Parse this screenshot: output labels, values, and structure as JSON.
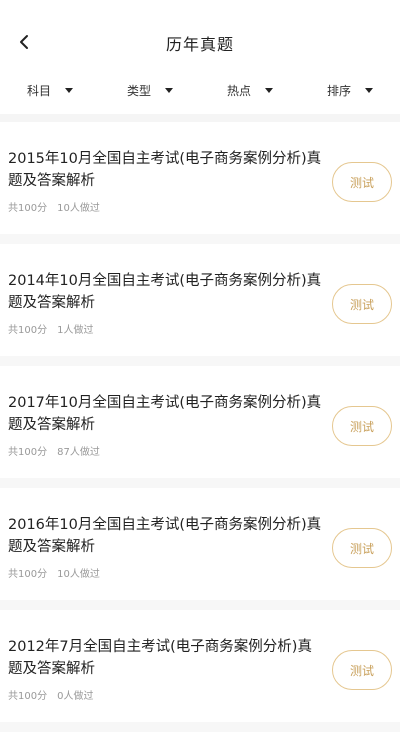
{
  "header": {
    "title": "历年真题"
  },
  "filters": [
    {
      "label": "科目"
    },
    {
      "label": "类型"
    },
    {
      "label": "热点"
    },
    {
      "label": "排序"
    }
  ],
  "items": [
    {
      "title": "2015年10月全国自主考试(电子商务案例分析)真题及答案解析",
      "score": "共100分",
      "done": "10人做过",
      "button": "测试"
    },
    {
      "title": "2014年10月全国自主考试(电子商务案例分析)真题及答案解析",
      "score": "共100分",
      "done": "1人做过",
      "button": "测试"
    },
    {
      "title": "2017年10月全国自主考试(电子商务案例分析)真题及答案解析",
      "score": "共100分",
      "done": "87人做过",
      "button": "测试"
    },
    {
      "title": "2016年10月全国自主考试(电子商务案例分析)真题及答案解析",
      "score": "共100分",
      "done": "10人做过",
      "button": "测试"
    },
    {
      "title": "2012年7月全国自主考试(电子商务案例分析)真题及答案解析",
      "score": "共100分",
      "done": "0人做过",
      "button": "测试"
    }
  ]
}
